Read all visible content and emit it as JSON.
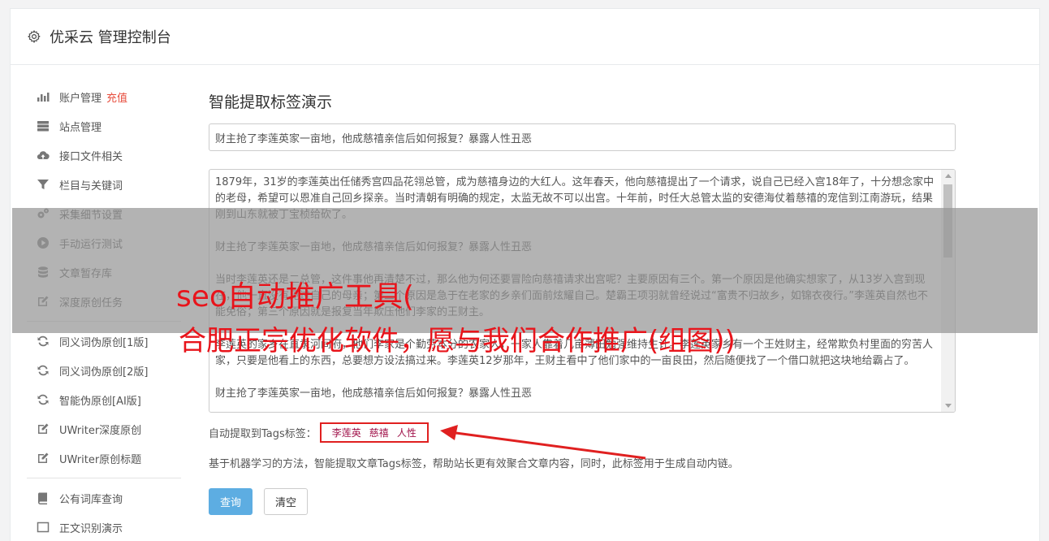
{
  "header": {
    "title": "优采云 管理控制台",
    "icon": "gear-icon"
  },
  "sidebar": {
    "group1": [
      {
        "icon": "bar-chart-icon",
        "label": "账户管理",
        "badge": "充值"
      },
      {
        "icon": "server-icon",
        "label": "站点管理"
      },
      {
        "icon": "cloud-upload-icon",
        "label": "接口文件相关"
      },
      {
        "icon": "filter-icon",
        "label": "栏目与关键词"
      },
      {
        "icon": "gears-icon",
        "label": "采集细节设置"
      },
      {
        "icon": "play-circle-icon",
        "label": "手动运行测试"
      },
      {
        "icon": "database-icon",
        "label": "文章暂存库"
      },
      {
        "icon": "edit-icon",
        "label": "深度原创任务"
      }
    ],
    "group2": [
      {
        "icon": "refresh-icon",
        "label": "同义词伪原创[1版]"
      },
      {
        "icon": "refresh-icon",
        "label": "同义词伪原创[2版]"
      },
      {
        "icon": "refresh-icon",
        "label": "智能伪原创[AI版]"
      },
      {
        "icon": "edit-icon",
        "label": "UWriter深度原创"
      },
      {
        "icon": "edit-icon",
        "label": "UWriter原创标题"
      }
    ],
    "group3": [
      {
        "icon": "book-icon",
        "label": "公有词库查询"
      },
      {
        "icon": "square-icon",
        "label": "正文识别演示"
      }
    ]
  },
  "main": {
    "heading": "智能提取标签演示",
    "title_value": "财主抢了李莲英家一亩地，他成慈禧亲信后如何报复？暴露人性丑恶",
    "paragraphs": [
      "1879年，31岁的李莲英出任储秀宫四品花翎总管，成为慈禧身边的大红人。这年春天，他向慈禧提出了一个请求，说自己已经入宫18年了，十分想念家中的老母，希望可以恩准自己回乡探亲。当时清朝有明确的规定，太监无故不可以出宫。十年前，时任大总管太监的安德海仗着慈禧的宠信到江南游玩，结果刚到山东就被丁宝桢给砍了。",
      "财主抢了李莲英家一亩地，他成慈禧亲信后如何报复？暴露人性丑恶",
      "当时李莲英还是二总管，这件事他再清楚不过，那么他为何还要冒险向慈禧请求出宫呢？主要原因有三个。第一个原因是他确实想家了，从13岁入宫到现在，他一直没有见过自己的母亲；第二个原因是急于在老家的乡亲们面前炫耀自己。楚霸王项羽就曾经说过“富贵不归故乡，如锦衣夜行。”李莲英自然也不能免俗；第三个原因就是报复当年欺压他们李家的王财主。",
      "李莲英的家乡在直隶河间府，他们李家是个勤劳本分的农家人，一家人靠着几亩薄田勉强维持生计。李莲英家乡有一个王姓财主，经常欺负村里面的穷苦人家，只要是他看上的东西，总要想方设法搞过来。李莲英12岁那年，王财主看中了他们家中的一亩良田，然后随便找了一个借口就把这块地给霸占了。",
      "财主抢了李莲英家一亩地，他成慈禧亲信后如何报复？暴露人性丑恶"
    ],
    "tags_label": "自动提取到Tags标签：",
    "tags": [
      "李莲英",
      "慈禧",
      "人性"
    ],
    "description": "基于机器学习的方法，智能提取文章Tags标签，帮助站长更有效聚合文章内容，同时，此标签用于生成自动内链。",
    "query_button": "查询",
    "clear_button": "清空"
  },
  "overlay": {
    "line1": "seo自动推广工具(",
    "line2": "合肥正宗优化软件，愿与我们合作推广(组图))"
  },
  "colors": {
    "accent": "#5dade2",
    "tag": "#a0124a",
    "badge": "#e74c3c",
    "overlay_text": "#e8141b",
    "highlight_border": "#e02020"
  }
}
